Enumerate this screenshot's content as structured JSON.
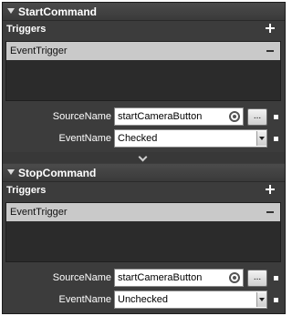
{
  "commands": [
    {
      "title": "StartCommand",
      "triggers_label": "Triggers",
      "trigger_item": "EventTrigger",
      "source_name_label": "SourceName",
      "source_name_value": "startCameraButton",
      "event_name_label": "EventName",
      "event_name_value": "Checked",
      "browse_label": "..."
    },
    {
      "title": "StopCommand",
      "triggers_label": "Triggers",
      "trigger_item": "EventTrigger",
      "source_name_label": "SourceName",
      "source_name_value": "startCameraButton",
      "event_name_label": "EventName",
      "event_name_value": "Unchecked",
      "browse_label": "..."
    }
  ],
  "icons": {
    "collapse": "triangle-down-icon",
    "add": "plus-icon",
    "remove": "minus-icon",
    "target": "target-icon",
    "dropdown": "chevron-down-icon",
    "splitter": "chevron-down-icon"
  },
  "colors": {
    "panel_bg": "#3c3c3c",
    "selected_item_bg": "#c9c9c9",
    "list_bg": "#2b2b2b",
    "text": "#ffffff"
  }
}
